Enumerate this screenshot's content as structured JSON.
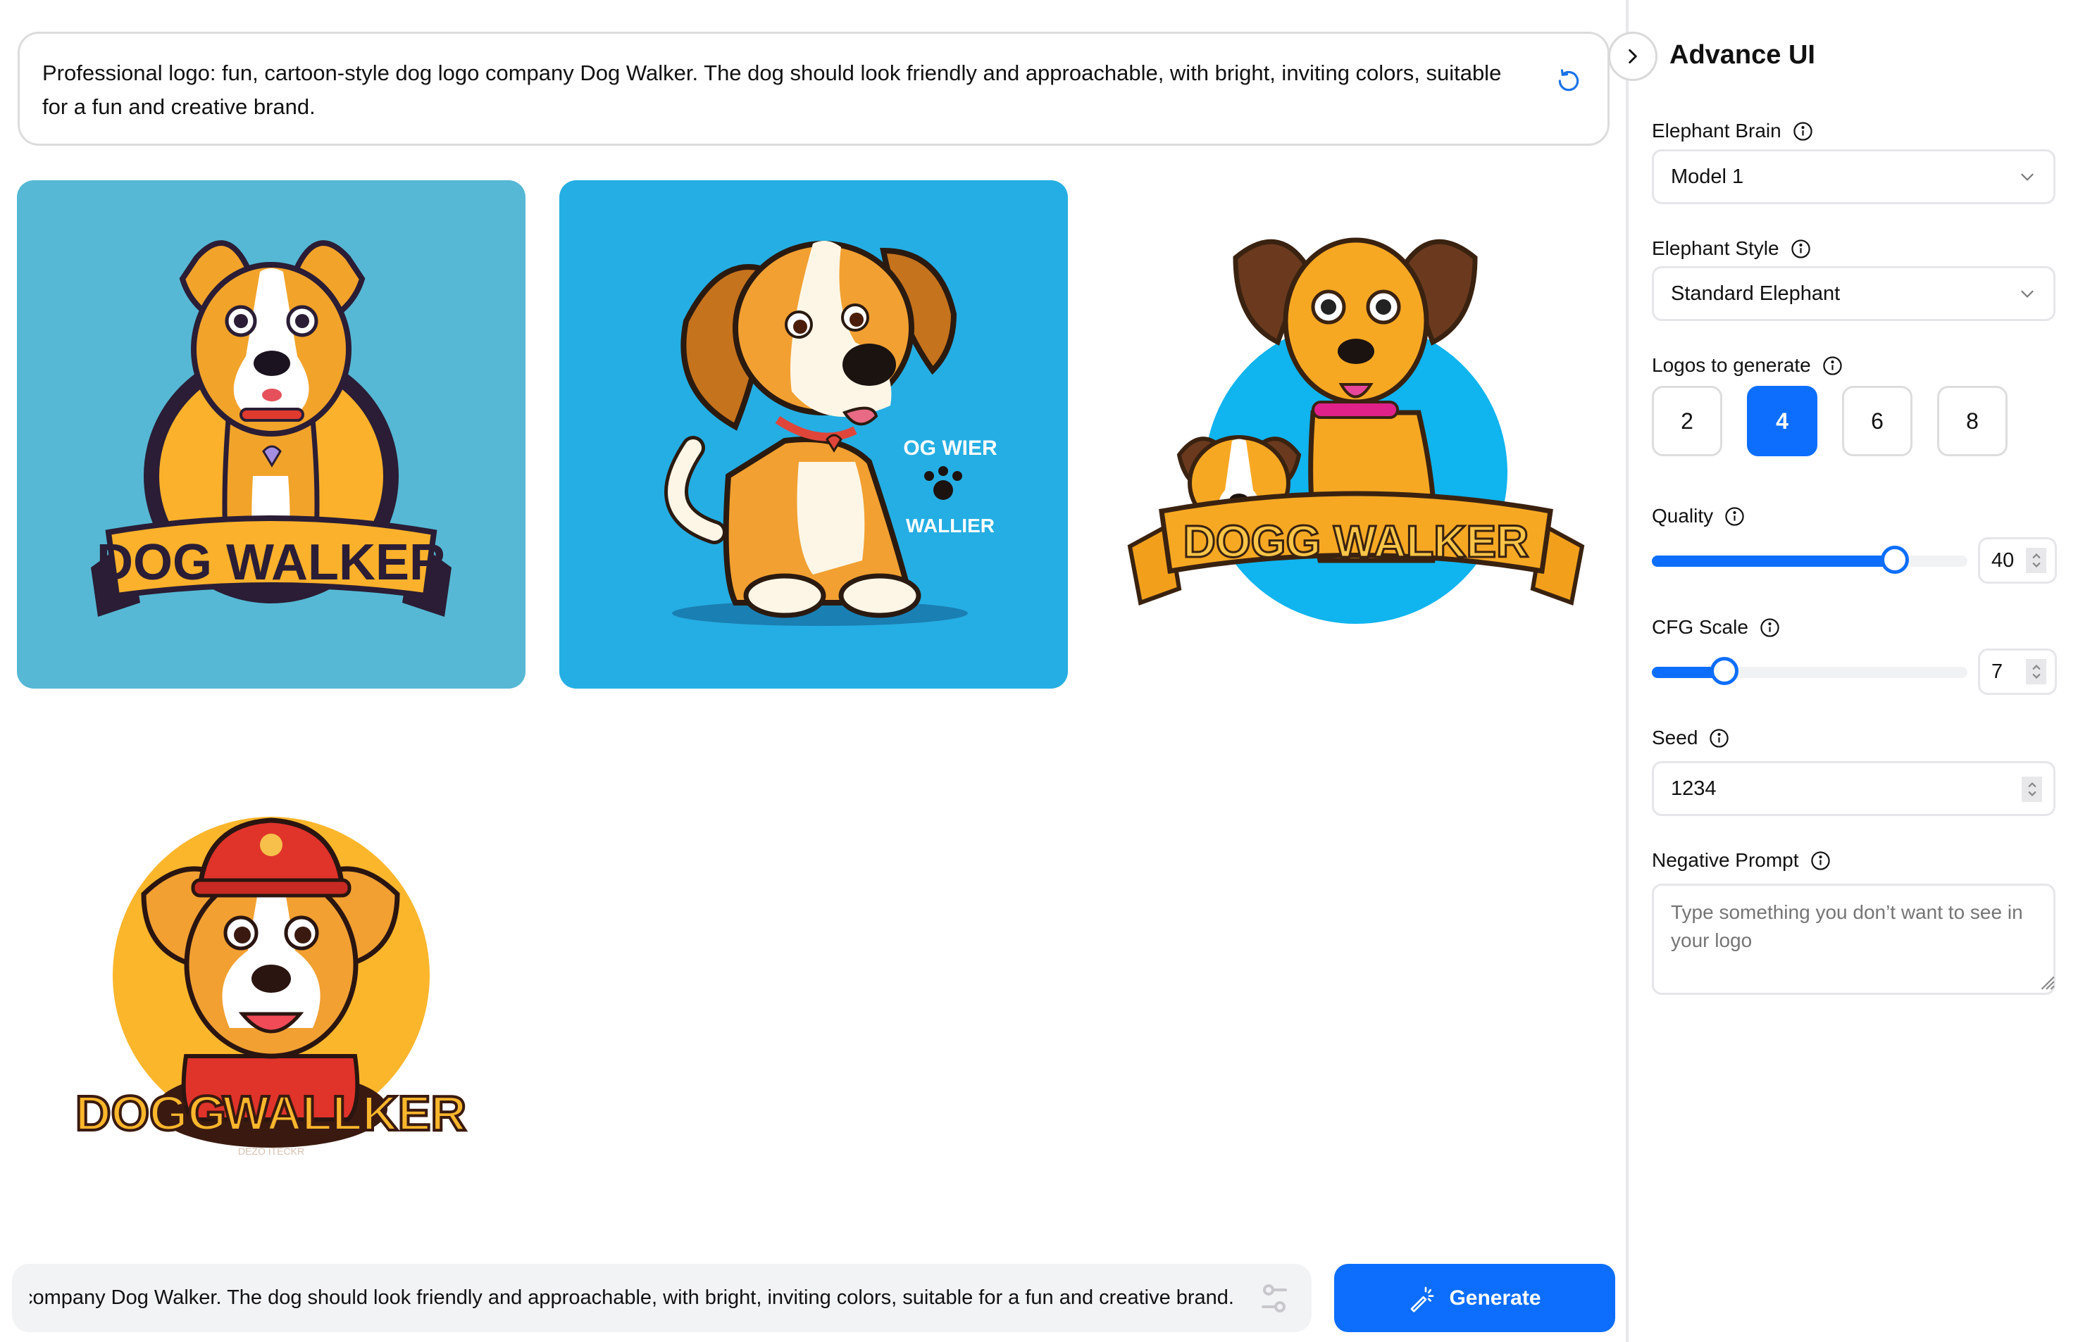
{
  "prompt": {
    "text": "Professional logo: fun, cartoon-style dog logo company Dog Walker. The dog should look friendly and approachable, with bright, inviting colors, suitable for a fun and creative brand.",
    "refresh_icon": "refresh-icon"
  },
  "gallery": {
    "images": [
      {
        "alt": "Dog Walker logo - sitting dog in circle with ribbon banner on teal background",
        "banner_text": "DOG WALKER",
        "background": "#56b8d4"
      },
      {
        "alt": "Cartoon beagle dog sitting with paw print badge on blue background",
        "badge_top": "OG WIER",
        "badge_bottom": "WALLIER",
        "background": "#25aee3"
      },
      {
        "alt": "Two cartoon dogs in blue circle with Dogg Walker ribbon banner",
        "banner_text": "DOGG WALKER",
        "background": "#ffffff"
      },
      {
        "alt": "Cartoon dog wearing red cap in yellow circle with Dogg Wallker text",
        "banner_text_1": "DOGG",
        "banner_text_2": "WALLKER",
        "tagline": "DEZO ITECKR",
        "background": "#ffffff"
      }
    ]
  },
  "bottom_bar": {
    "input_value": "Professional logo: fun, cartoon-style dog logo company Dog Walker. The dog should look friendly and approachable, with bright, inviting colors, suitable for a fun and creative brand.",
    "settings_icon": "sliders-icon",
    "generate_label": "Generate",
    "generate_icon": "magic-wand-icon"
  },
  "sidebar": {
    "toggle_icon": "chevron-right-icon",
    "title": "Advance UI",
    "brain": {
      "label": "Elephant Brain",
      "value": "Model 1"
    },
    "style": {
      "label": "Elephant Style",
      "value": "Standard Elephant"
    },
    "logos": {
      "label": "Logos to generate",
      "options": [
        "2",
        "4",
        "6",
        "8"
      ],
      "selected": "4"
    },
    "quality": {
      "label": "Quality",
      "value": "40",
      "fraction": 0.77
    },
    "cfg": {
      "label": "CFG Scale",
      "value": "7",
      "fraction": 0.23
    },
    "seed": {
      "label": "Seed",
      "value": "1234"
    },
    "negative": {
      "label": "Negative Prompt",
      "placeholder": "Type something you don’t want to see in your logo"
    }
  },
  "colors": {
    "accent": "#0d6efd",
    "border": "#e6e6ea",
    "input_bg": "#f2f3f5",
    "placeholder": "#6b7280"
  }
}
